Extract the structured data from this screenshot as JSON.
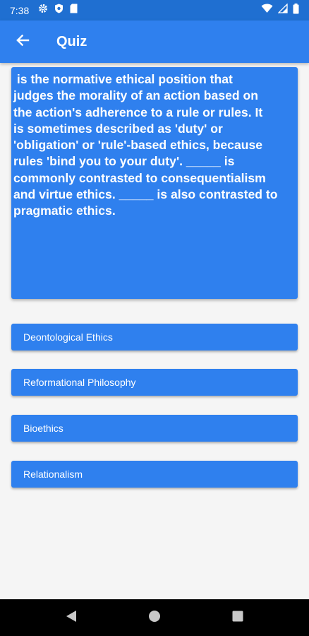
{
  "status_bar": {
    "time": "7:38",
    "icons": [
      "gear-icon",
      "shield-icon",
      "sd-card-icon",
      "wifi-icon",
      "signal-icon",
      "battery-icon"
    ]
  },
  "app_bar": {
    "title": "Quiz",
    "back_icon": "arrow-back-icon"
  },
  "question": {
    "text": " is the normative ethical position that\njudges the morality of an action based on\nthe action's adherence to a rule or rules. It\nis sometimes described as 'duty' or\n'obligation' or 'rule'-based ethics, because\nrules 'bind you to your duty'. _____ is\ncommonly contrasted to consequentialism\nand virtue ethics. _____ is also contrasted to\npragmatic ethics."
  },
  "answers": [
    {
      "label": "Deontological Ethics"
    },
    {
      "label": "Reformational Philosophy"
    },
    {
      "label": "Bioethics"
    },
    {
      "label": "Relationalism"
    }
  ],
  "nav_bar": {
    "icons": [
      "back-triangle-icon",
      "home-circle-icon",
      "recents-square-icon"
    ]
  },
  "colors": {
    "primary": "#2f80ee",
    "status_bar": "#1f6fd1",
    "background": "#f5f5f5",
    "nav_bar": "#000000"
  }
}
